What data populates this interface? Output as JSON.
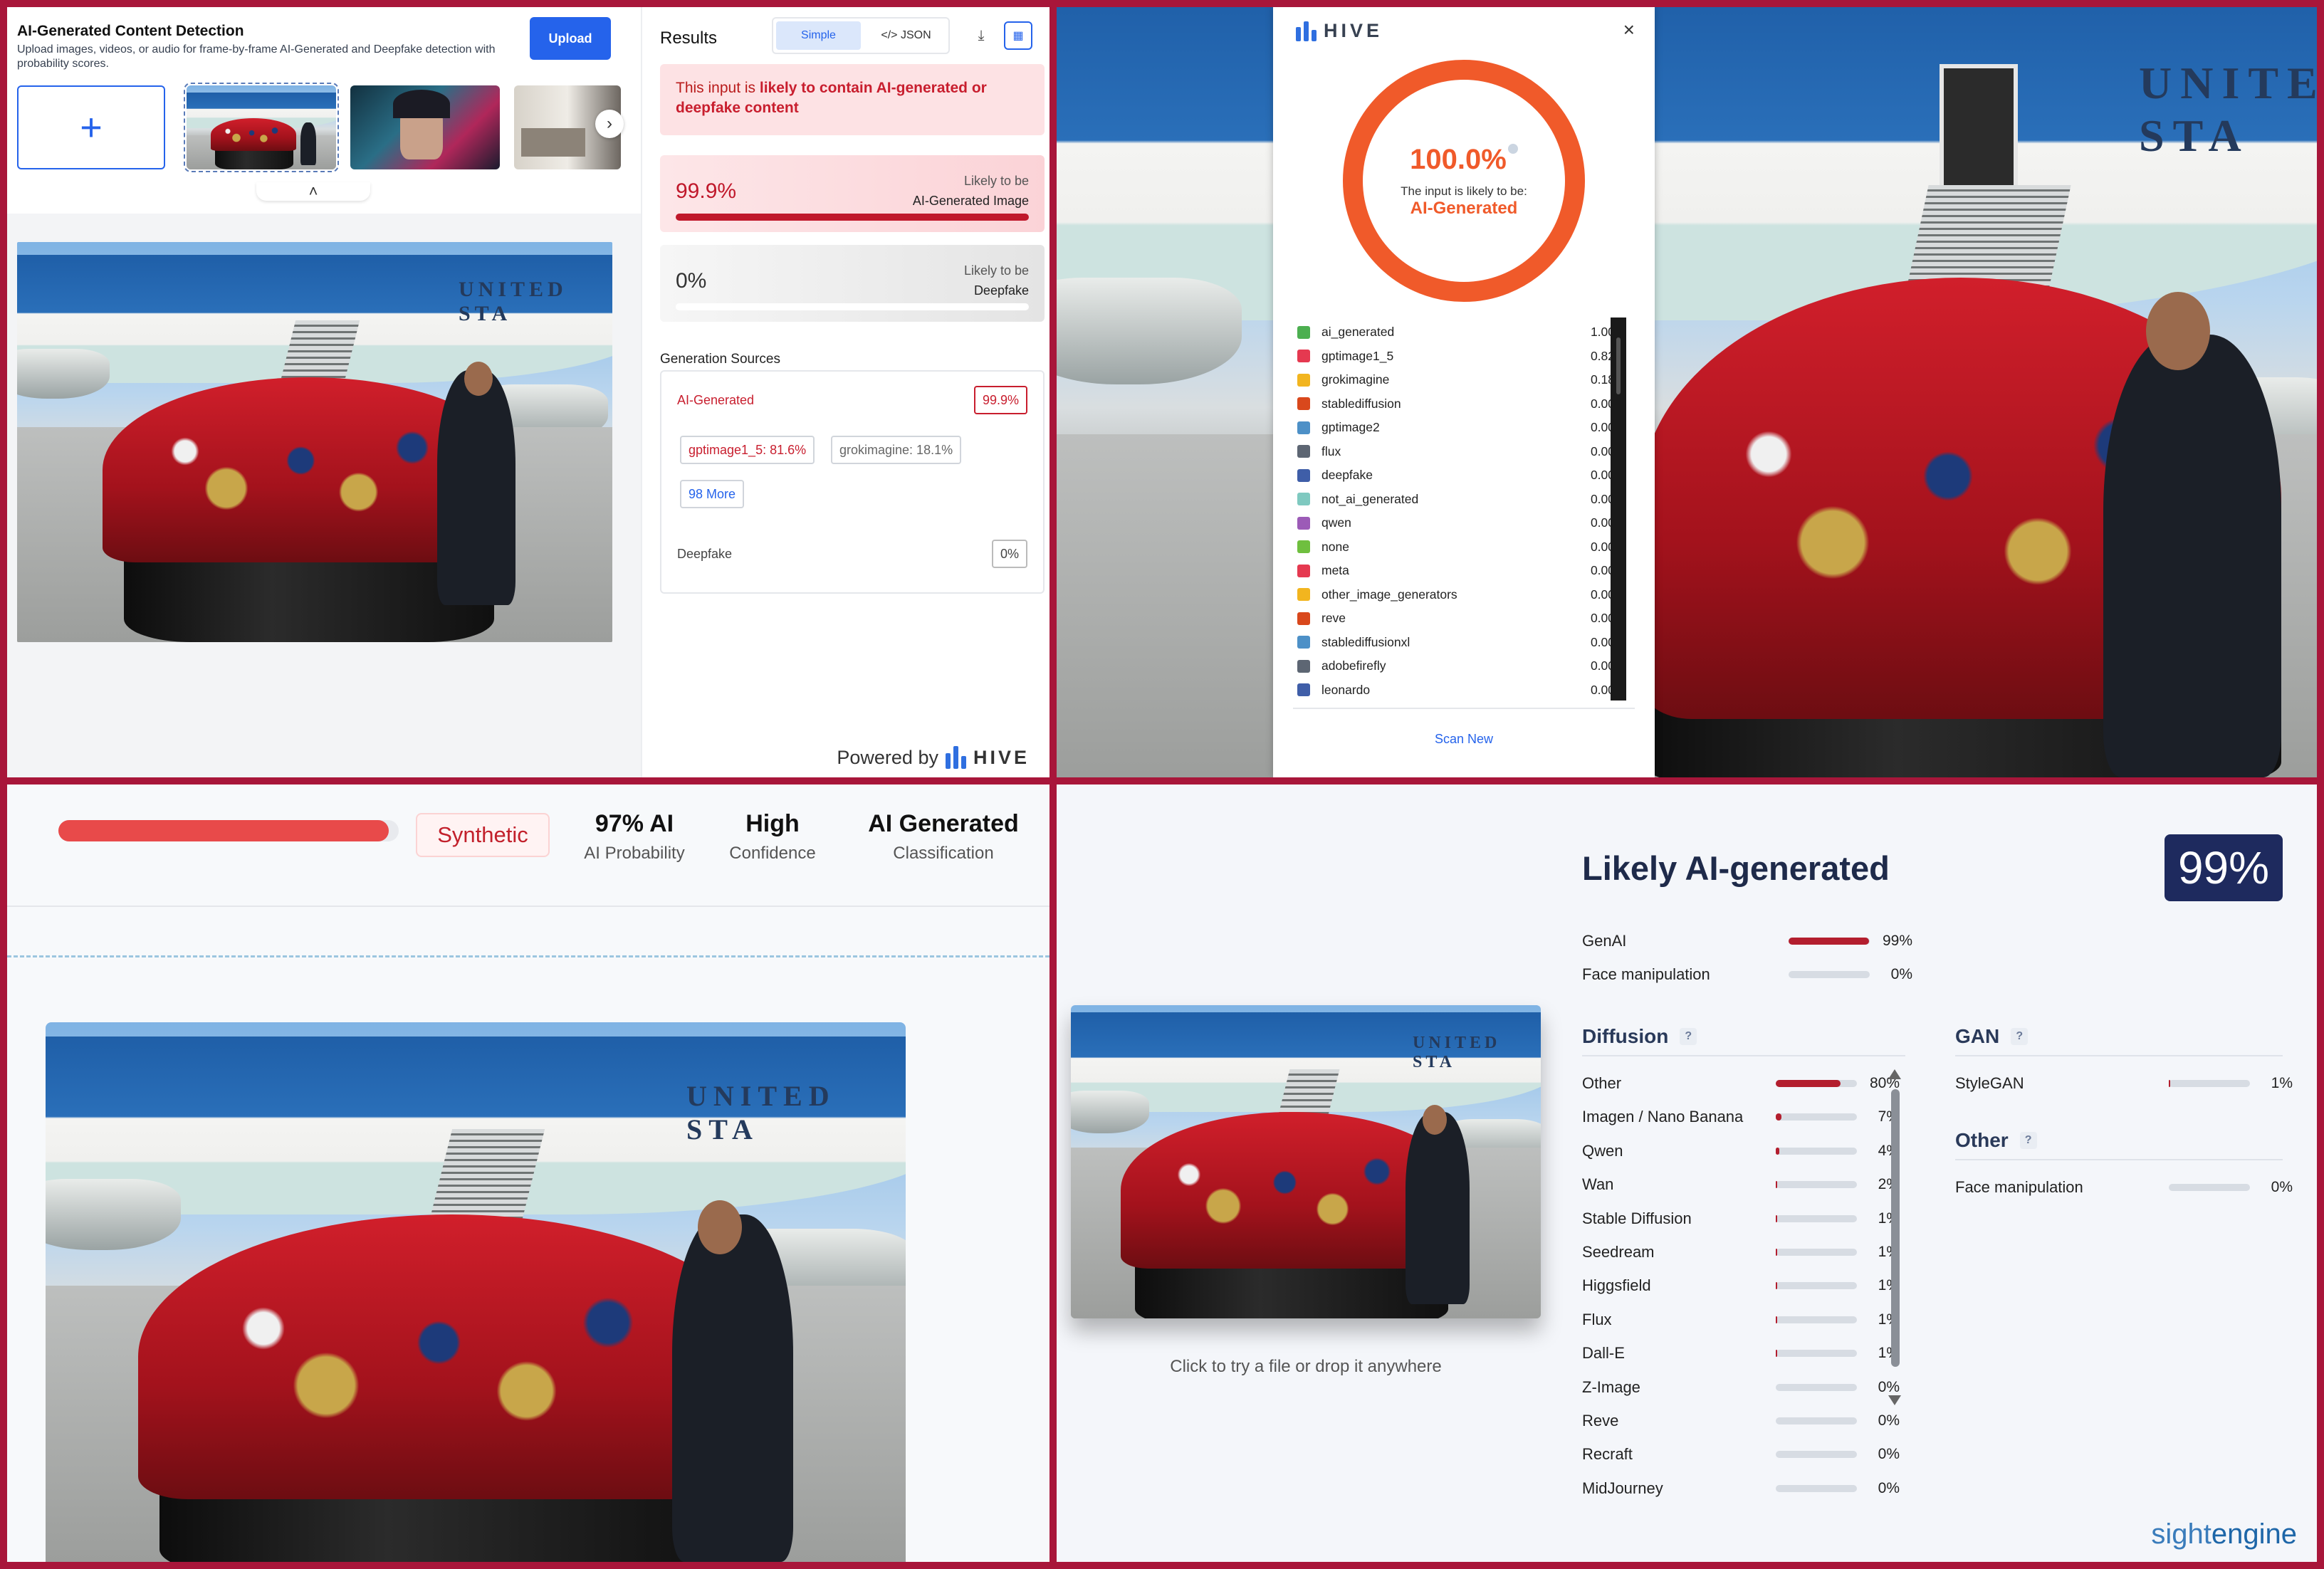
{
  "tl": {
    "title": "AI-Generated Content Detection",
    "subtitle": "Upload images, videos, or audio for frame-by-frame AI-Generated and Deepfake detection with probability scores.",
    "upload_label": "Upload",
    "add_label": "+",
    "next_label": "›",
    "collapse_label": "˄",
    "results_title": "Results",
    "tab_simple": "Simple",
    "tab_json": "</> JSON",
    "download_icon": "download-icon",
    "layout_icon": "layout-icon",
    "alert_prefix": "This input is ",
    "alert_strong": "likely to contain AI-generated or deepfake content",
    "card_ai": {
      "pct": "99.9%",
      "likely": "Likely to be",
      "label": "AI-Generated Image",
      "fill": 0.999
    },
    "card_df": {
      "pct": "0%",
      "likely": "Likely to be",
      "label": "Deepfake",
      "fill": 0.0
    },
    "gen_sources_title": "Generation Sources",
    "src_ai_label": "AI-Generated",
    "src_ai_pct": "99.9%",
    "pill_1": "gptimage1_5: 81.6%",
    "pill_2": "grokimagine: 18.1%",
    "pill_more": "98 More",
    "src_df_label": "Deepfake",
    "src_df_pct": "0%",
    "powered_by": "Powered by",
    "brand": "HIVE"
  },
  "tr": {
    "brand": "HIVE",
    "close": "×",
    "score": "100.0%",
    "likely": "The input is likely to be:",
    "verdict": "AI-Generated",
    "scan_new": "Scan New",
    "scores": [
      {
        "name": "ai_generated",
        "value": "1.00",
        "color": "#4caf50"
      },
      {
        "name": "gptimage1_5",
        "value": "0.82",
        "color": "#e53950"
      },
      {
        "name": "grokimagine",
        "value": "0.18",
        "color": "#f2b51f"
      },
      {
        "name": "stablediffusion",
        "value": "0.00",
        "color": "#d9481c"
      },
      {
        "name": "gptimage2",
        "value": "0.00",
        "color": "#4d90c7"
      },
      {
        "name": "flux",
        "value": "0.00",
        "color": "#5d6673"
      },
      {
        "name": "deepfake",
        "value": "0.00",
        "color": "#3f5ea8"
      },
      {
        "name": "not_ai_generated",
        "value": "0.00",
        "color": "#7fc9c0"
      },
      {
        "name": "qwen",
        "value": "0.00",
        "color": "#9c5bb7"
      },
      {
        "name": "none",
        "value": "0.00",
        "color": "#6fbf3f"
      },
      {
        "name": "meta",
        "value": "0.00",
        "color": "#e53950"
      },
      {
        "name": "other_image_generators",
        "value": "0.00",
        "color": "#f2b51f"
      },
      {
        "name": "reve",
        "value": "0.00",
        "color": "#d9481c"
      },
      {
        "name": "stablediffusionxl",
        "value": "0.00",
        "color": "#4d90c7"
      },
      {
        "name": "adobefirefly",
        "value": "0.00",
        "color": "#5d6673"
      },
      {
        "name": "leonardo",
        "value": "0.00",
        "color": "#3f5ea8"
      }
    ]
  },
  "bl": {
    "fill": 0.97,
    "tag": "Synthetic",
    "stat1_value": "97% AI",
    "stat1_key": "AI Probability",
    "stat2_value": "High",
    "stat2_key": "Confidence",
    "stat3_value": "AI Generated",
    "stat3_key": "Classification"
  },
  "br": {
    "title": "Likely AI-generated",
    "badge": "99%",
    "top_rows": [
      {
        "name": "GenAI",
        "pct": "99%",
        "fill": 0.99
      },
      {
        "name": "Face manipulation",
        "pct": "0%",
        "fill": 0.0
      }
    ],
    "diffusion_title": "Diffusion",
    "diffusion_rows": [
      {
        "name": "Other",
        "pct": "80%",
        "fill": 0.8
      },
      {
        "name": "Imagen / Nano Banana",
        "pct": "7%",
        "fill": 0.07
      },
      {
        "name": "Qwen",
        "pct": "4%",
        "fill": 0.04
      },
      {
        "name": "Wan",
        "pct": "2%",
        "fill": 0.02
      },
      {
        "name": "Stable Diffusion",
        "pct": "1%",
        "fill": 0.01
      },
      {
        "name": "Seedream",
        "pct": "1%",
        "fill": 0.01
      },
      {
        "name": "Higgsfield",
        "pct": "1%",
        "fill": 0.01
      },
      {
        "name": "Flux",
        "pct": "1%",
        "fill": 0.01
      },
      {
        "name": "Dall-E",
        "pct": "1%",
        "fill": 0.01
      },
      {
        "name": "Z-Image",
        "pct": "0%",
        "fill": 0.0
      },
      {
        "name": "Reve",
        "pct": "0%",
        "fill": 0.0
      },
      {
        "name": "Recraft",
        "pct": "0%",
        "fill": 0.0
      },
      {
        "name": "MidJourney",
        "pct": "0%",
        "fill": 0.0
      }
    ],
    "gan_title": "GAN",
    "gan_rows": [
      {
        "name": "StyleGAN",
        "pct": "1%",
        "fill": 0.01
      }
    ],
    "other_title": "Other",
    "other_rows": [
      {
        "name": "Face manipulation",
        "pct": "0%",
        "fill": 0.0
      }
    ],
    "help_icon": "?",
    "hint": "Click to try a file or drop it anywhere",
    "brand_a": "sight",
    "brand_b": "engine"
  },
  "photo_text": "UNITED STA"
}
